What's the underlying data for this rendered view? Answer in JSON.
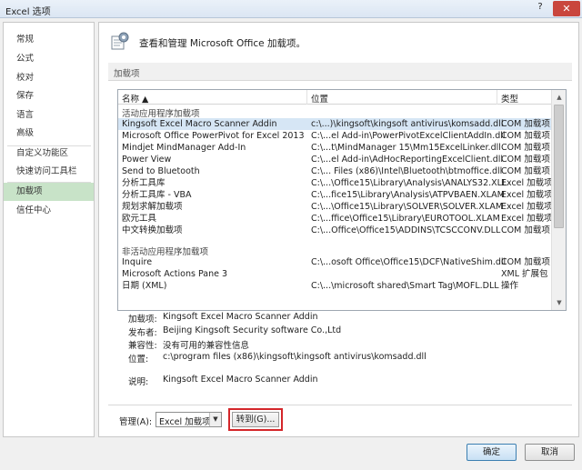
{
  "window": {
    "title": "Excel 选项",
    "help": "?",
    "close": "✕"
  },
  "sidebar": {
    "items": [
      {
        "label": "常规"
      },
      {
        "label": "公式"
      },
      {
        "label": "校对"
      },
      {
        "label": "保存"
      },
      {
        "label": "语言"
      },
      {
        "label": "高级"
      },
      {
        "label": "自定义功能区"
      },
      {
        "label": "快速访问工具栏"
      },
      {
        "label": "加载项"
      },
      {
        "label": "信任中心"
      }
    ],
    "active": "加载项"
  },
  "header": {
    "text": "查看和管理 Microsoft Office 加载项。"
  },
  "section": {
    "title": "加载项"
  },
  "table": {
    "columns": [
      "名称 ▲",
      "位置",
      "类型"
    ],
    "groups": [
      {
        "title": "活动应用程序加载项",
        "rows": [
          {
            "name": "Kingsoft Excel Macro Scanner Addin",
            "location": "c:\\...)\\kingsoft\\kingsoft antivirus\\komsadd.dll",
            "type": "COM 加载项"
          },
          {
            "name": "Microsoft Office PowerPivot for Excel 2013",
            "location": "C:\\...el Add-in\\PowerPivotExcelClientAddIn.dll",
            "type": "COM 加载项"
          },
          {
            "name": "Mindjet MindManager Add-In",
            "location": "C:\\...t\\MindManager 15\\Mm15ExcelLinker.dll",
            "type": "COM 加载项"
          },
          {
            "name": "Power View",
            "location": "C:\\...el Add-in\\AdHocReportingExcelClient.dll",
            "type": "COM 加载项"
          },
          {
            "name": "Send to Bluetooth",
            "location": "C:\\... Files (x86)\\Intel\\Bluetooth\\btmoffice.dll",
            "type": "COM 加载项"
          },
          {
            "name": "分析工具库",
            "location": "C:\\...\\Office15\\Library\\Analysis\\ANALYS32.XLL",
            "type": "Excel 加载项"
          },
          {
            "name": "分析工具库 - VBA",
            "location": "C:\\...fice15\\Library\\Analysis\\ATPVBAEN.XLAM",
            "type": "Excel 加载项"
          },
          {
            "name": "规划求解加载项",
            "location": "C:\\...\\Office15\\Library\\SOLVER\\SOLVER.XLAM",
            "type": "Excel 加载项"
          },
          {
            "name": "欧元工具",
            "location": "C:\\...ffice\\Office15\\Library\\EUROTOOL.XLAM",
            "type": "Excel 加载项"
          },
          {
            "name": "中文转换加载项",
            "location": "C:\\...Office\\Office15\\ADDINS\\TCSCCONV.DLL",
            "type": "COM 加载项"
          }
        ]
      },
      {
        "title": "非活动应用程序加载项",
        "rows": [
          {
            "name": "Inquire",
            "location": "C:\\...osoft Office\\Office15\\DCF\\NativeShim.dll",
            "type": "COM 加载项"
          },
          {
            "name": "Microsoft Actions Pane 3",
            "location": "",
            "type": "XML 扩展包"
          },
          {
            "name": "日期 (XML)",
            "location": "C:\\...\\microsoft shared\\Smart Tag\\MOFL.DLL",
            "type": "操作"
          }
        ]
      }
    ]
  },
  "details": [
    {
      "label": "加载项:",
      "value": "Kingsoft Excel Macro Scanner Addin"
    },
    {
      "label": "发布者:",
      "value": "Beijing Kingsoft Security software Co.,Ltd"
    },
    {
      "label": "兼容性:",
      "value": "没有可用的兼容性信息"
    },
    {
      "label": "位置:",
      "value": "c:\\program files (x86)\\kingsoft\\kingsoft antivirus\\komsadd.dll"
    },
    {
      "label": "说明:",
      "value": "Kingsoft Excel Macro Scanner Addin"
    }
  ],
  "manage": {
    "label": "管理(A):",
    "selected": "Excel 加载项",
    "goto": "转到(G)..."
  },
  "buttons": {
    "ok": "确定",
    "cancel": "取消"
  },
  "colors": {
    "active_nav": "#c8e3c8",
    "selected_row": "#d6e6f5",
    "highlight_box": "#d4262a"
  }
}
